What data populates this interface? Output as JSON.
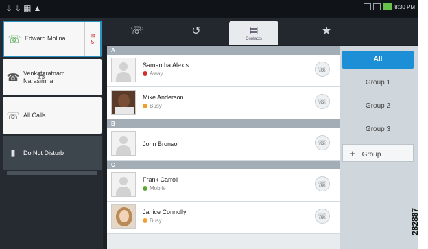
{
  "status_bar": {
    "left_icons": [
      "notification-icon",
      "notification-icon",
      "notification-icon",
      "warning-icon"
    ],
    "time": "8:30 PM"
  },
  "left_panel": {
    "active_call": {
      "name": "Edward Molina",
      "badge_count": "5"
    },
    "held_call": {
      "name": "Venkataratnam Narasimha",
      "badge_count": "23"
    },
    "all_calls": "All Calls",
    "dnd": "Do Not Disturb"
  },
  "tabs": [
    {
      "icon": "phone-icon"
    },
    {
      "icon": "recent-icon"
    },
    {
      "icon": "contacts-icon",
      "label": "Contacts"
    },
    {
      "icon": "star-icon"
    }
  ],
  "sections": [
    {
      "letter": "A",
      "contacts": [
        {
          "name": "Samantha Alexis",
          "status": "Away",
          "status_color": "#d32f2f"
        },
        {
          "name": "Mike Anderson",
          "status": "Busy",
          "status_color": "#f0a030"
        }
      ]
    },
    {
      "letter": "B",
      "contacts": [
        {
          "name": "John Bronson",
          "status": "",
          "status_color": ""
        }
      ]
    },
    {
      "letter": "C",
      "contacts": [
        {
          "name": "Frank Carroll",
          "status": "Mobile",
          "status_color": "#5aa832"
        },
        {
          "name": "Janice Connolly",
          "status": "Busy",
          "status_color": "#f0a030"
        }
      ]
    }
  ],
  "groups": {
    "all": "All",
    "g1": "Group 1",
    "g2": "Group 2",
    "g3": "Group 3",
    "add": "Group"
  },
  "figure_id": "282887"
}
